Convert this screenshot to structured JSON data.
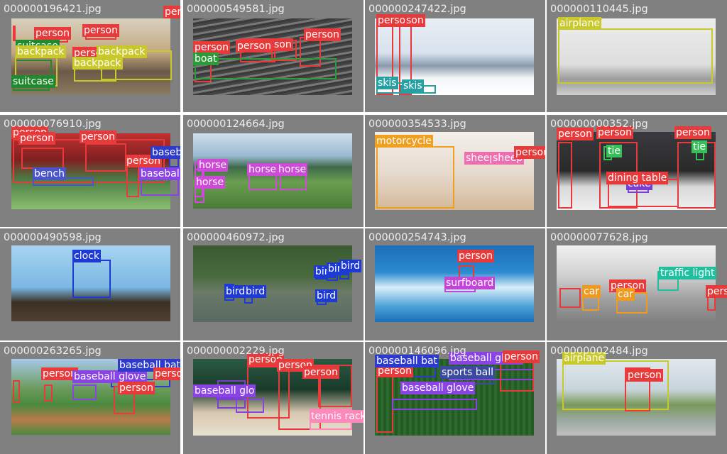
{
  "colors": {
    "person": "#e83a3a",
    "suitcase": "#1f8a2e",
    "backpack": "#c8c82a",
    "boat": "#2e9a3a",
    "skis": "#26a0a0",
    "airplane": "#c9c92a",
    "bench": "#4a55cc",
    "baseball bat": "#2c3ad0",
    "baseball glove": "#8a44e6",
    "horse": "#cf4ad8",
    "motorcycle": "#f0a020",
    "sheep": "#ee6fb0",
    "tie": "#37c05a",
    "cake": "#7a3fd1",
    "dining table": "#e83a3a",
    "clock": "#1e3ad4",
    "bird": "#1e3ad4",
    "surfboard": "#c245d6",
    "car": "#f09a20",
    "traffic light": "#1fc0a0",
    "chair": "#7a3fd1",
    "tennis racket": "#ff88bb",
    "sports ball": "#3a4aa0"
  },
  "tiles": [
    {
      "filename": "000000196421.jpg",
      "labels": [
        {
          "t": "person",
          "c": "person"
        },
        {
          "t": "person",
          "c": "person"
        },
        {
          "t": "person",
          "c": "person"
        },
        {
          "t": "suitcase",
          "c": "suitcase"
        },
        {
          "t": "backpack",
          "c": "backpack"
        },
        {
          "t": "person",
          "c": "person"
        },
        {
          "t": "backpack",
          "c": "backpack"
        },
        {
          "t": "backpack",
          "c": "backpack"
        },
        {
          "t": "suitcase",
          "c": "suitcase"
        }
      ]
    },
    {
      "filename": "000000549581.jpg",
      "labels": [
        {
          "t": "person",
          "c": "person"
        },
        {
          "t": "person",
          "c": "person"
        },
        {
          "t": "person",
          "c": "person"
        },
        {
          "t": "son",
          "c": "person"
        },
        {
          "t": "boat",
          "c": "boat"
        }
      ]
    },
    {
      "filename": "000000247422.jpg",
      "labels": [
        {
          "t": "person",
          "c": "person"
        },
        {
          "t": "son",
          "c": "person"
        },
        {
          "t": "skis",
          "c": "skis"
        },
        {
          "t": "skis",
          "c": "skis"
        }
      ]
    },
    {
      "filename": "000000110445.jpg",
      "labels": [
        {
          "t": "airplane",
          "c": "airplane"
        }
      ]
    },
    {
      "filename": "000000076910.jpg",
      "labels": [
        {
          "t": "person",
          "c": "person"
        },
        {
          "t": "person",
          "c": "person"
        },
        {
          "t": "person",
          "c": "person"
        },
        {
          "t": "bench",
          "c": "bench"
        },
        {
          "t": "person",
          "c": "person"
        },
        {
          "t": "baseball glove",
          "c": "baseball glove"
        },
        {
          "t": "baseball bat",
          "c": "baseball bat"
        }
      ]
    },
    {
      "filename": "000000124664.jpg",
      "labels": [
        {
          "t": "horse",
          "c": "horse"
        },
        {
          "t": "horse",
          "c": "horse"
        },
        {
          "t": "horse",
          "c": "horse"
        },
        {
          "t": "horse",
          "c": "horse"
        }
      ]
    },
    {
      "filename": "000000354533.jpg",
      "labels": [
        {
          "t": "motorcycle",
          "c": "motorcycle"
        },
        {
          "t": "sheep",
          "c": "sheep"
        },
        {
          "t": "sheep",
          "c": "sheep"
        },
        {
          "t": "person",
          "c": "person"
        }
      ]
    },
    {
      "filename": "000000000352.jpg",
      "labels": [
        {
          "t": "person",
          "c": "person"
        },
        {
          "t": "person",
          "c": "person"
        },
        {
          "t": "person",
          "c": "person"
        },
        {
          "t": "tie",
          "c": "tie"
        },
        {
          "t": "tie",
          "c": "tie"
        },
        {
          "t": "cake",
          "c": "cake"
        },
        {
          "t": "dining table",
          "c": "dining table"
        }
      ]
    },
    {
      "filename": "000000490598.jpg",
      "labels": [
        {
          "t": "clock",
          "c": "clock"
        }
      ]
    },
    {
      "filename": "000000460972.jpg",
      "labels": [
        {
          "t": "bird",
          "c": "bird"
        },
        {
          "t": "bird",
          "c": "bird"
        },
        {
          "t": "bird",
          "c": "bird"
        },
        {
          "t": "bird",
          "c": "bird"
        },
        {
          "t": "bird",
          "c": "bird"
        },
        {
          "t": "bird",
          "c": "bird"
        }
      ]
    },
    {
      "filename": "000000254743.jpg",
      "labels": [
        {
          "t": "person",
          "c": "person"
        },
        {
          "t": "surfboard",
          "c": "surfboard"
        }
      ]
    },
    {
      "filename": "000000077628.jpg",
      "labels": [
        {
          "t": "person",
          "c": "person"
        },
        {
          "t": "car",
          "c": "car"
        },
        {
          "t": "traffic light",
          "c": "traffic light"
        },
        {
          "t": "car",
          "c": "car"
        },
        {
          "t": "person",
          "c": "person"
        }
      ]
    },
    {
      "filename": "000000263265.jpg",
      "labels": [
        {
          "t": "person",
          "c": "person"
        },
        {
          "t": "baseball glove",
          "c": "baseball glove"
        },
        {
          "t": "baseball bat",
          "c": "baseball bat"
        },
        {
          "t": "person",
          "c": "person"
        },
        {
          "t": "person",
          "c": "person"
        }
      ]
    },
    {
      "filename": "000000002229.jpg",
      "labels": [
        {
          "t": "person",
          "c": "person"
        },
        {
          "t": "person",
          "c": "person"
        },
        {
          "t": "person",
          "c": "person"
        },
        {
          "t": "chair",
          "c": "chair"
        },
        {
          "t": "baseball glo",
          "c": "baseball glove"
        },
        {
          "t": "tennis racket",
          "c": "tennis racket"
        }
      ]
    },
    {
      "filename": "000000146096.jpg",
      "labels": [
        {
          "t": "person",
          "c": "person"
        },
        {
          "t": "baseball bat",
          "c": "baseball bat"
        },
        {
          "t": "sports ball",
          "c": "sports ball"
        },
        {
          "t": "baseball glove",
          "c": "baseball glove"
        },
        {
          "t": "baseball glove",
          "c": "baseball glove"
        },
        {
          "t": "person",
          "c": "person"
        }
      ]
    },
    {
      "filename": "000000002484.jpg",
      "labels": [
        {
          "t": "airplane",
          "c": "airplane"
        },
        {
          "t": "person",
          "c": "person"
        }
      ]
    }
  ]
}
